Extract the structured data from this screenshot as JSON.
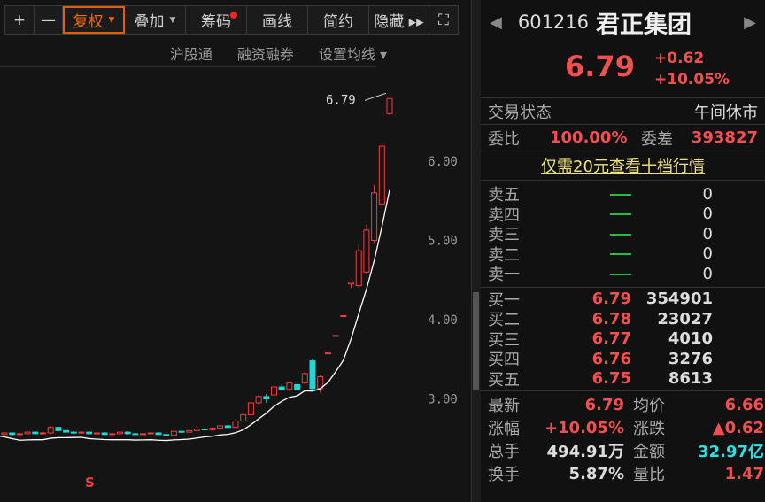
{
  "toolbar": {
    "plus": "+",
    "minus": "—",
    "fuquan": "复权",
    "diejia": "叠加",
    "chouma": "筹码",
    "huaxian": "画线",
    "jianyue": "简约",
    "yincang": "隐藏 ▸▸",
    "fullscreen": "⛶"
  },
  "subbar": {
    "hugutong": "沪股通",
    "rongzi": "融资融券",
    "junxian": "设置均线 ▾"
  },
  "chart": {
    "last_label": "6.79",
    "s_marker": "S",
    "y_ticks": [
      "6.00",
      "5.00",
      "4.00",
      "3.00"
    ],
    "colors": {
      "up": "#f03c3c",
      "down": "#21d6d6",
      "ma": "#ffffff"
    },
    "candles": [
      [
        2.55,
        2.56,
        2.57,
        2.53
      ],
      [
        2.56,
        2.55,
        2.57,
        2.54
      ],
      [
        2.55,
        2.57,
        2.58,
        2.54
      ],
      [
        2.57,
        2.55,
        2.58,
        2.54
      ],
      [
        2.55,
        2.56,
        2.57,
        2.54
      ],
      [
        2.56,
        2.58,
        2.59,
        2.55
      ],
      [
        2.58,
        2.56,
        2.59,
        2.55
      ],
      [
        2.56,
        2.57,
        2.58,
        2.55
      ],
      [
        2.57,
        2.64,
        2.66,
        2.56
      ],
      [
        2.64,
        2.6,
        2.65,
        2.59
      ],
      [
        2.6,
        2.58,
        2.61,
        2.57
      ],
      [
        2.58,
        2.57,
        2.59,
        2.56
      ],
      [
        2.57,
        2.58,
        2.59,
        2.56
      ],
      [
        2.58,
        2.56,
        2.59,
        2.55
      ],
      [
        2.56,
        2.57,
        2.58,
        2.55
      ],
      [
        2.57,
        2.55,
        2.58,
        2.54
      ],
      [
        2.55,
        2.56,
        2.57,
        2.54
      ],
      [
        2.56,
        2.58,
        2.59,
        2.55
      ],
      [
        2.58,
        2.56,
        2.59,
        2.55
      ],
      [
        2.56,
        2.55,
        2.57,
        2.54
      ],
      [
        2.55,
        2.56,
        2.57,
        2.54
      ],
      [
        2.56,
        2.57,
        2.58,
        2.55
      ],
      [
        2.57,
        2.55,
        2.58,
        2.54
      ],
      [
        2.55,
        2.54,
        2.56,
        2.53
      ],
      [
        2.54,
        2.59,
        2.6,
        2.53
      ],
      [
        2.59,
        2.58,
        2.6,
        2.57
      ],
      [
        2.58,
        2.6,
        2.61,
        2.57
      ],
      [
        2.6,
        2.62,
        2.64,
        2.59
      ],
      [
        2.62,
        2.61,
        2.63,
        2.6
      ],
      [
        2.61,
        2.63,
        2.64,
        2.6
      ],
      [
        2.63,
        2.66,
        2.67,
        2.62
      ],
      [
        2.66,
        2.64,
        2.67,
        2.63
      ],
      [
        2.64,
        2.72,
        2.74,
        2.63
      ],
      [
        2.72,
        2.8,
        2.82,
        2.7
      ],
      [
        2.8,
        2.95,
        2.97,
        2.79
      ],
      [
        2.95,
        3.03,
        3.05,
        2.93
      ],
      [
        3.03,
        3.0,
        3.06,
        2.95
      ],
      [
        3.05,
        3.15,
        3.17,
        3.03
      ],
      [
        3.15,
        3.12,
        3.18,
        3.1
      ],
      [
        3.12,
        3.2,
        3.22,
        3.1
      ],
      [
        3.18,
        3.12,
        3.23,
        3.1
      ],
      [
        3.2,
        3.32,
        3.34,
        3.18
      ],
      [
        3.48,
        3.13,
        3.5,
        3.1
      ],
      [
        3.13,
        3.28,
        3.3,
        3.08
      ],
      [
        3.58,
        3.58,
        3.58,
        3.58
      ],
      [
        3.8,
        3.8,
        3.8,
        3.8
      ],
      [
        4.05,
        4.05,
        4.05,
        4.05
      ],
      [
        4.45,
        4.47,
        4.47,
        4.4
      ],
      [
        4.43,
        4.87,
        4.95,
        4.4
      ],
      [
        4.6,
        5.13,
        5.2,
        4.58
      ],
      [
        5.0,
        5.6,
        5.7,
        4.96
      ],
      [
        5.46,
        6.19,
        6.19,
        5.4
      ],
      [
        6.6,
        6.79,
        6.79,
        6.58
      ]
    ]
  },
  "quote": {
    "code": "601216",
    "name": "君正集团",
    "price": "6.79",
    "change": "+0.62",
    "pct": "+10.05%",
    "status_label": "交易状态",
    "status": "午间休市",
    "weibi_label": "委比",
    "weibi": "100.00%",
    "weicha_label": "委差",
    "weicha": "393827",
    "promo": "仅需20元查看十档行情",
    "sell": [
      {
        "label": "卖五",
        "vol": "0"
      },
      {
        "label": "卖四",
        "vol": "0"
      },
      {
        "label": "卖三",
        "vol": "0"
      },
      {
        "label": "卖二",
        "vol": "0"
      },
      {
        "label": "卖一",
        "vol": "0"
      }
    ],
    "buy": [
      {
        "label": "买一",
        "price": "6.79",
        "vol": "354901"
      },
      {
        "label": "买二",
        "price": "6.78",
        "vol": "23027"
      },
      {
        "label": "买三",
        "price": "6.77",
        "vol": "4010"
      },
      {
        "label": "买四",
        "price": "6.76",
        "vol": "3276"
      },
      {
        "label": "买五",
        "price": "6.75",
        "vol": "8613"
      }
    ],
    "stats": [
      {
        "l1": "最新",
        "v1": "6.79",
        "l2": "均价",
        "v2": "6.66"
      },
      {
        "l1": "涨幅",
        "v1": "+10.05%",
        "l2": "涨跌",
        "v2": "▲0.62"
      },
      {
        "l1": "总手",
        "v1": "494.91万",
        "l2": "金额",
        "v2": "32.97亿"
      },
      {
        "l1": "换手",
        "v1": "5.87%",
        "l2": "量比",
        "v2": "1.47"
      }
    ]
  }
}
